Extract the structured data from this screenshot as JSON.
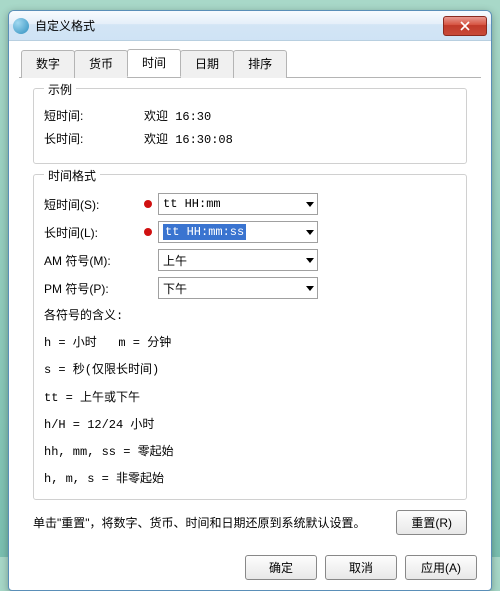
{
  "window": {
    "title": "自定义格式"
  },
  "tabs": {
    "number": "数字",
    "currency": "货币",
    "time": "时间",
    "date": "日期",
    "sort": "排序"
  },
  "example": {
    "group_title": "示例",
    "short_label": "短时间:",
    "short_value": "欢迎 16:30",
    "long_label": "长时间:",
    "long_value": "欢迎 16:30:08"
  },
  "format": {
    "group_title": "时间格式",
    "short_label": "短时间(S):",
    "short_value": "tt HH:mm",
    "long_label": "长时间(L):",
    "long_value": "tt HH:mm:ss",
    "am_label": "AM 符号(M):",
    "am_value": "上午",
    "pm_label": "PM 符号(P):",
    "pm_value": "下午"
  },
  "legend": {
    "title": "各符号的含义:",
    "l1": "h = 小时   m = 分钟",
    "l2": "s = 秒(仅限长时间)",
    "l3": "tt = 上午或下午",
    "l4": "h/H = 12/24 小时",
    "l5": "hh, mm, ss = 零起始",
    "l6": "h, m, s = 非零起始"
  },
  "reset": {
    "text": "单击\"重置\"，将数字、货币、时间和日期还原到系统默认设置。",
    "button": "重置(R)"
  },
  "buttons": {
    "ok": "确定",
    "cancel": "取消",
    "apply": "应用(A)"
  }
}
